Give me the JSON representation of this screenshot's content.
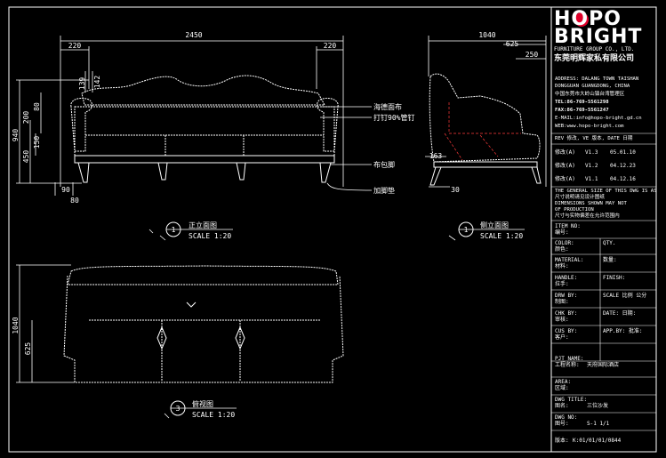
{
  "brand": {
    "logo": "HOPO",
    "name": "BRIGHT",
    "subtitle": "FURNITURE GROUP CO., LTD.",
    "chinese": "东莞明辉家私有限公司"
  },
  "views": {
    "front": {
      "number": "1",
      "title": "正立面图",
      "scale": "SCALE 1:20"
    },
    "side": {
      "number": "1",
      "title": "侧立面图",
      "scale": "SCALE 1:20"
    },
    "top": {
      "number": "3",
      "title": "俯视图",
      "scale": "SCALE 1:20"
    }
  },
  "dimensions": {
    "front_width": "2450",
    "front_arm_left": "220",
    "front_arm_right": "220",
    "front_height": "940",
    "front_seat_h1": "450",
    "front_seat_h2": "200",
    "front_seat_h3": "150",
    "front_back_1": "139",
    "front_back_2": "142",
    "front_back_3": "80",
    "front_leg_1": "90",
    "front_leg_2": "80",
    "side_depth": "1040",
    "side_top": "625",
    "side_arm": "250",
    "side_leg": "163",
    "side_bottom": "30",
    "top_depth": "1040",
    "top_seat": "625"
  },
  "callouts": {
    "fabric": "海德面布",
    "piping": "打钉90%管钉",
    "wrap": "布包脚",
    "leg": "加脚垫"
  },
  "title_block": {
    "address_lines": [
      "ADDRESS: DALANG TOWN TAISHAN",
      "DONGGUAN GUANGDONG, CHINA",
      "中国东莞市大岭山镇台湾管理区",
      "TEL:86-769-5561298",
      "FAX:86-769-5561247",
      "E-MAIL:info@hopo-bright.gd.cn",
      "WEB:www.hopo-bright.com"
    ],
    "rev_header": "REV 修改, VE 版本, DATE 日期",
    "revisions": [
      {
        "by": "修改(A)",
        "ver": "V1.3",
        "date": "05.01.10"
      },
      {
        "by": "修改(A)",
        "ver": "V1.2",
        "date": "04.12.23"
      },
      {
        "by": "修改(A)",
        "ver": "V1.1",
        "date": "04.12.16"
      }
    ],
    "notes": [
      "THE GENERAL SIZE OF THIS DWG IS AS",
      "尺寸说明请见设计图纸",
      "DIMENSIONS SHOWN MAY NOT",
      "OF PRODUCTION",
      "尺寸与实物偏差在允许范围内"
    ],
    "fields": [
      {
        "en": "ITEM NO:",
        "cn": "编号:",
        "value": ""
      },
      {
        "en": "COLOR:",
        "cn": "颜色:",
        "value": "QTY."
      },
      {
        "en": "MATERIAL:",
        "cn": "材料:",
        "value": "数量:"
      },
      {
        "en": "HANDLE:",
        "cn": "拉手:",
        "value": "FINISH:"
      },
      {
        "en": "DRW BY:",
        "cn": "制图:",
        "value": "SCALE 比例  公分"
      },
      {
        "en": "CHK BY:",
        "cn": "审核:",
        "value": "DATE: 日期:"
      },
      {
        "en": "CUS BY:",
        "cn": "客户:",
        "value": "APP.BY: 批准:"
      },
      {
        "en": "PJT NAME:",
        "cn": "工程名称:",
        "value": "天府国际酒店"
      },
      {
        "en": "AREA:",
        "cn": "区域:",
        "value": ""
      },
      {
        "en": "DWG TITLE:",
        "cn": "图名:",
        "value": "三位沙发"
      },
      {
        "en": "DWG NO:",
        "cn": "图号:",
        "value": "S-1   1/1"
      },
      {
        "en": "版本:",
        "cn": "",
        "value": "K:01/01/01/0844"
      }
    ]
  },
  "colors": {
    "background": "#000000",
    "lines": "#ffffff",
    "hatch": "#ff3b3b",
    "accent": "#e0002a"
  }
}
